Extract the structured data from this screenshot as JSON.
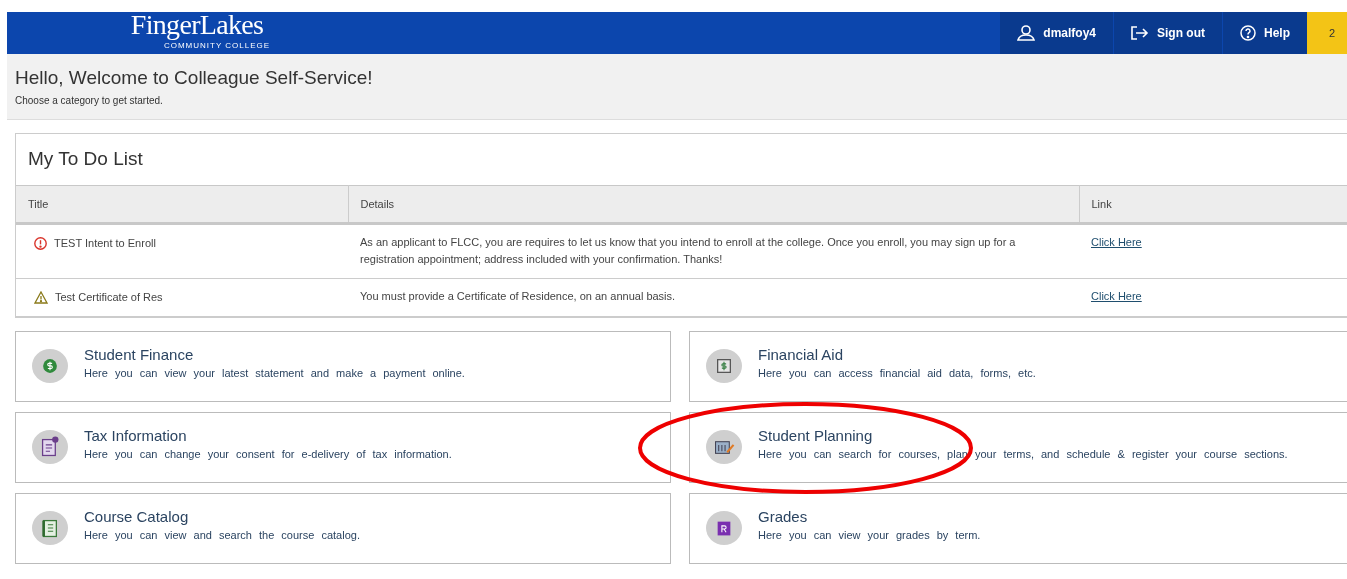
{
  "header": {
    "logo": "FingerLakes",
    "logo_subtitle": "COMMUNITY COLLEGE",
    "user": "dmalfoy4",
    "sign_out": "Sign out",
    "help": "Help",
    "badge": "2"
  },
  "welcome": {
    "title": "Hello, Welcome to Colleague Self-Service!",
    "subtitle": "Choose a category to get started."
  },
  "todo": {
    "title": "My To Do List",
    "columns": [
      "Title",
      "Details",
      "Link"
    ],
    "rows": [
      {
        "kind": "error",
        "title": "TEST Intent to Enroll",
        "details": "As an applicant to FLCC, you are requires to let us know that you intend to enroll at the college. Once you enroll, you may sign up for a registration appointment; address included with your confirmation. Thanks!",
        "link": "Click Here"
      },
      {
        "kind": "warning",
        "title": "Test Certificate of Res",
        "details": "You must provide a Certificate of Residence, on an annual basis.",
        "link": "Click Here"
      }
    ]
  },
  "tiles": [
    {
      "kind": "finance",
      "title": "Student Finance",
      "description": "Here you can view your latest statement and make a payment online."
    },
    {
      "kind": "aid",
      "title": "Financial Aid",
      "description": "Here you can access financial aid data, forms, etc."
    },
    {
      "kind": "tax",
      "title": "Tax Information",
      "description": "Here you can change your consent for e-delivery of tax information."
    },
    {
      "kind": "planning",
      "title": "Student Planning",
      "description": "Here you can search for courses, plan your terms, and schedule & register your course sections."
    },
    {
      "kind": "catalog",
      "title": "Course Catalog",
      "description": "Here you can view and search the course catalog."
    },
    {
      "kind": "grades",
      "title": "Grades",
      "description": "Here you can view your grades by term."
    }
  ]
}
